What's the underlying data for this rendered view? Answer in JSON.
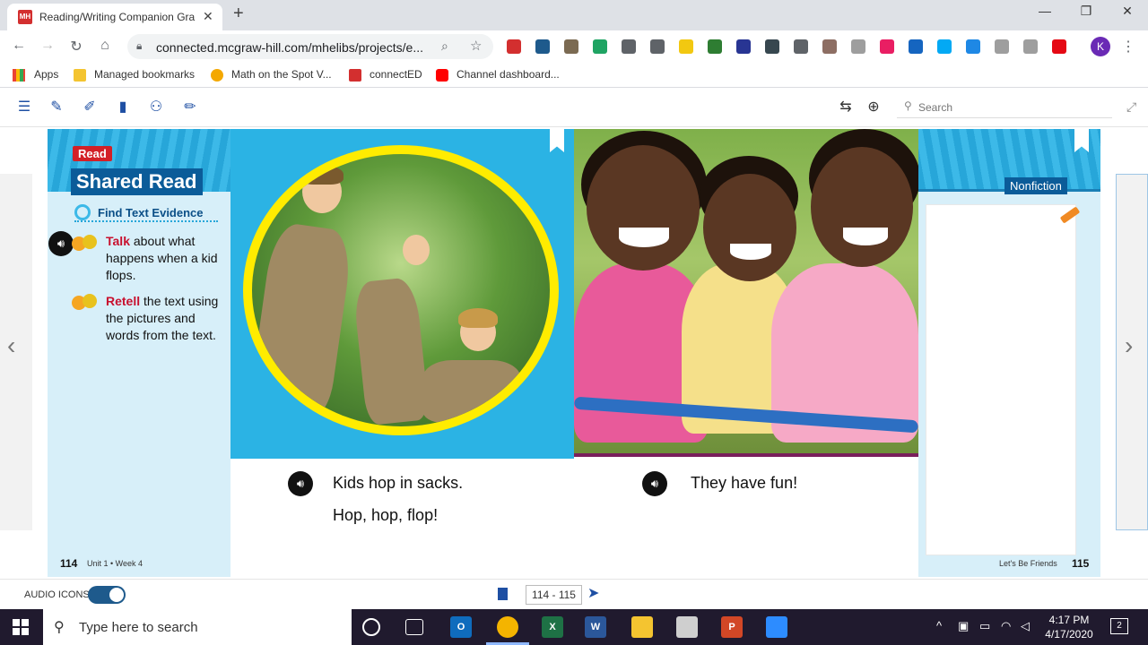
{
  "browser": {
    "tab_title": "Reading/Writing Companion Gra",
    "tab_close": "✕",
    "new_tab": "+",
    "url": "connected.mcgraw-hill.com/mhelibs/projects/e...",
    "window_controls": [
      "—",
      "❐",
      "✕"
    ],
    "profile_initial": "K",
    "extensions": [
      {
        "name": "adblock-icon",
        "color": "#d32f2f"
      },
      {
        "name": "shield-icon",
        "color": "#1e5a8c"
      },
      {
        "name": "reader-icon",
        "color": "#7b6a52"
      },
      {
        "name": "drive-icon",
        "color": "#1fa463"
      },
      {
        "name": "scissors-icon",
        "color": "#5f6368"
      },
      {
        "name": "badge-icon",
        "color": "#5f6368"
      },
      {
        "name": "notes-icon",
        "color": "#f2c811"
      },
      {
        "name": "grid-icon",
        "color": "#2e7d32"
      },
      {
        "name": "k-icon",
        "color": "#283593"
      },
      {
        "name": "dots-icon",
        "color": "#37474f"
      },
      {
        "name": "camera-icon",
        "color": "#5f6368"
      },
      {
        "name": "face-icon",
        "color": "#8d6e63"
      },
      {
        "name": "screenshot-icon",
        "color": "#9e9e9e"
      },
      {
        "name": "t-icon",
        "color": "#e91e63"
      },
      {
        "name": "puzzle-icon",
        "color": "#1565c0"
      },
      {
        "name": "windows-icon",
        "color": "#03a9f4"
      },
      {
        "name": "share-icon",
        "color": "#1e88e5"
      },
      {
        "name": "drive-outline-icon",
        "color": "#9e9e9e"
      },
      {
        "name": "np-icon",
        "color": "#9e9e9e"
      },
      {
        "name": "netflix-icon",
        "color": "#e50914"
      }
    ],
    "bookmarks": [
      "Apps",
      "Managed bookmarks",
      "Math on the Spot V...",
      "connectED",
      "Channel dashboard..."
    ]
  },
  "toolbar": {
    "search_placeholder": "Search"
  },
  "left_page": {
    "read_tag": "Read",
    "section_title": "Shared Read",
    "find_evidence": "Find Text Evidence",
    "instruction1_keyword": "Talk",
    "instruction1_rest": " about what happens when a kid flops.",
    "instruction2_keyword": "Retell",
    "instruction2_rest": " the text using the pictures and words from the text.",
    "page_number": "114",
    "unit_week": "Unit 1 • Week 4",
    "story_line1": "Kids hop in sacks.",
    "story_line2": "Hop, hop, flop!"
  },
  "right_page": {
    "genre": "Nonfiction",
    "story_line1": "They have fun!",
    "theme": "Let's Be Friends",
    "page_number": "115"
  },
  "bottom_bar": {
    "audio_label": "AUDIO ICONS:",
    "audio_on": true,
    "page_range": "114 - 115"
  },
  "taskbar": {
    "search_text": "Type here to search",
    "time": "4:17 PM",
    "date": "4/17/2020",
    "notifications": "2"
  }
}
